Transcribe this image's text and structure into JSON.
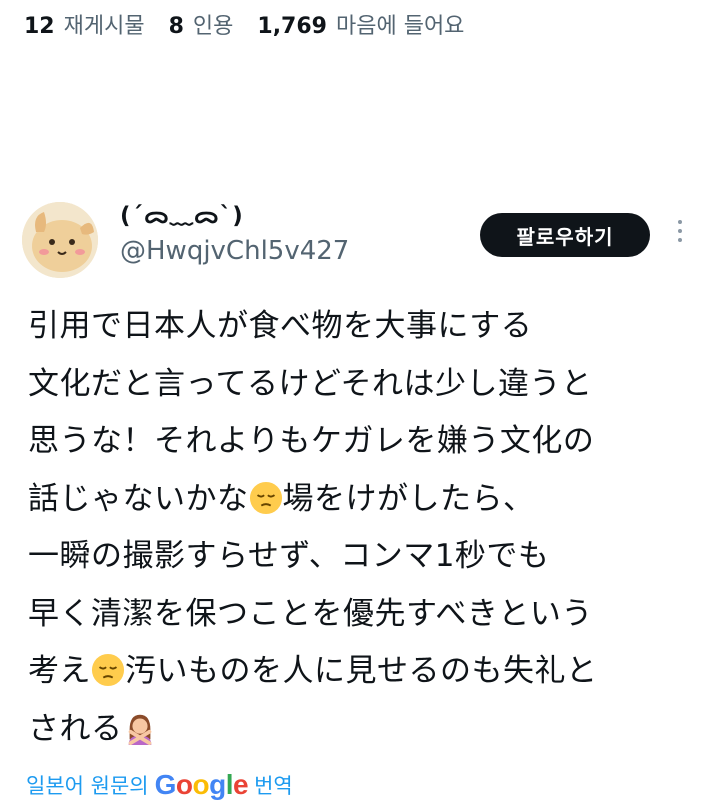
{
  "stats": [
    {
      "count": "12",
      "label": "재게시물"
    },
    {
      "count": "8",
      "label": "인용"
    },
    {
      "count": "1,769",
      "label": "마음에 들어요"
    }
  ],
  "tweet": {
    "display_name": "(´ᯅ﹏ᯅ`)",
    "handle": "@HwqjvChl5v427",
    "follow_label": "팔로우하기",
    "body": {
      "l1": "引用で日本人が食べ物を大事にする",
      "l2": "文化だと言ってるけどそれは少し違うと",
      "l3": "思うな！それよりもケガレを嫌う文化の",
      "l4a": "話じゃないかな",
      "l4b": "場をけがしたら、",
      "l5": "一瞬の撮影すらせず、コンマ1秒でも",
      "l6": "早く清潔を保つことを優先すべきという",
      "l7a": "考え",
      "l7b": "汚いものを人に見せるのも失礼と",
      "l8": "される"
    },
    "emojis": {
      "pensive": "pensive-face",
      "no": "person-gesturing-no"
    }
  },
  "translate": {
    "prefix": "일본어 원문의",
    "brand": {
      "g1": "G",
      "o1": "o",
      "o2": "o",
      "g2": "g",
      "l": "l",
      "e": "e"
    },
    "suffix": "번역"
  },
  "colors": {
    "text": "#0f1419",
    "muted": "#536471",
    "link": "#1d9bf0",
    "button": "#0f1419"
  }
}
